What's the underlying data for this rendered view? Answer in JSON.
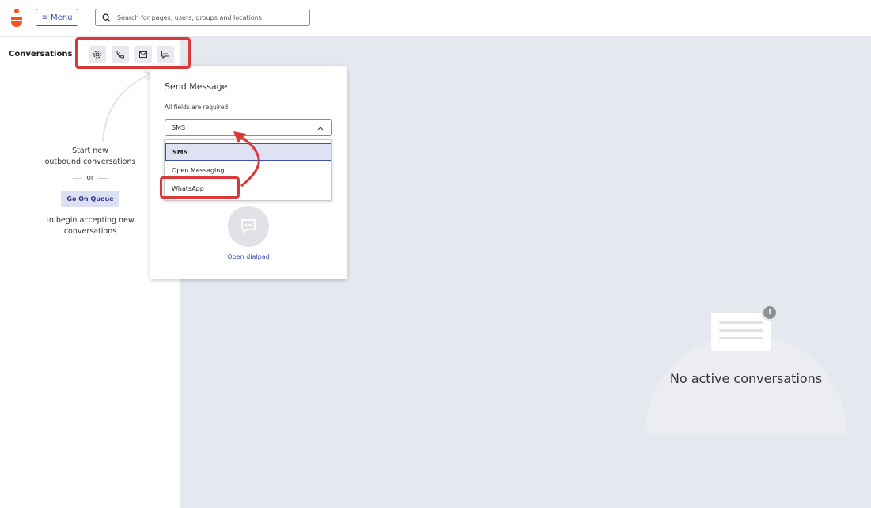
{
  "topbar": {
    "menu_label": "Menu",
    "search_placeholder": "Search for pages, users, groups and locations"
  },
  "left_panel": {
    "title": "Conversations",
    "action_icons": [
      "gear-icon",
      "phone-icon",
      "mail-icon",
      "chat-icon"
    ],
    "start_line1": "Start new",
    "start_line2": "outbound conversations",
    "or": "or",
    "queue_button": "Go On Queue",
    "accept_line1": "to begin accepting new",
    "accept_line2": "conversations"
  },
  "popup": {
    "title": "Send Message",
    "subtitle": "All fields are required",
    "selected_value": "SMS",
    "options": [
      "SMS",
      "Open Messaging",
      "WhatsApp"
    ],
    "dialpad_link": "Open dialpad"
  },
  "main": {
    "empty_text": "No active conversations"
  },
  "colors": {
    "accent": "#3d4fa7",
    "highlight": "#d83a3a",
    "logo": "#ff4f1f"
  }
}
